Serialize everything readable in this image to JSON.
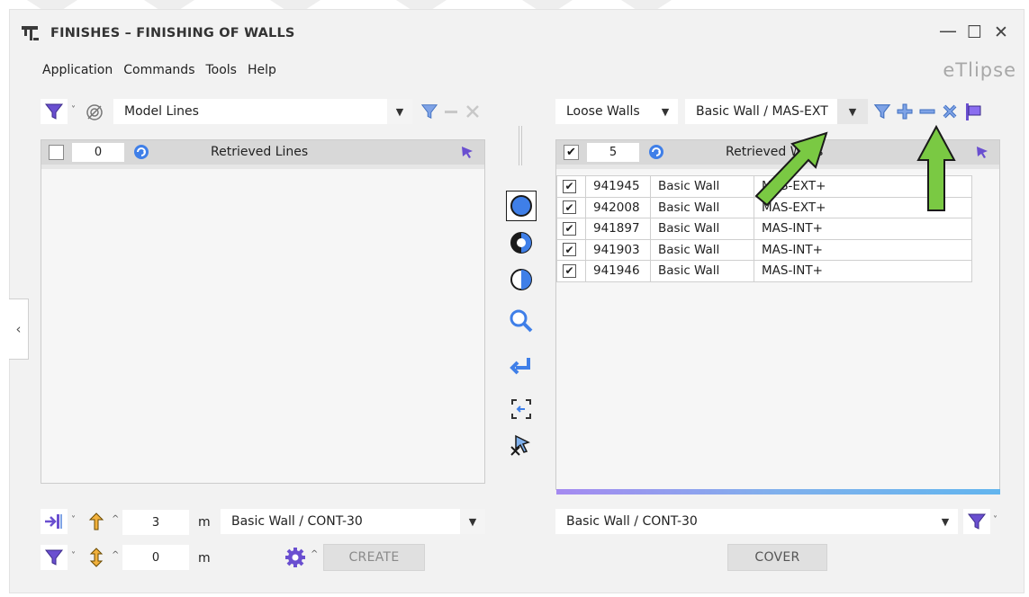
{
  "window": {
    "title": "FINISHES – FINISHING OF WALLS",
    "brand": "eTlipse",
    "minimize": "—",
    "maximize": "☐",
    "close": "✕"
  },
  "menu": [
    "Application",
    "Commands",
    "Tools",
    "Help"
  ],
  "left": {
    "category_select": "Model Lines",
    "count": "0",
    "header_title": "Retrieved Lines",
    "offset_value": "3",
    "offset_unit": "m",
    "wall_type_select": "Basic Wall / CONT-30",
    "height_value": "0",
    "height_unit": "m",
    "create_button": "CREATE"
  },
  "right": {
    "source_select": "Loose Walls",
    "type_select": "Basic Wall / MAS-EXT",
    "count": "5",
    "header_title": "Retrieved Walls",
    "rows": [
      {
        "id": "941945",
        "family": "Basic Wall",
        "type": "MAS-EXT+",
        "checked": true
      },
      {
        "id": "942008",
        "family": "Basic Wall",
        "type": "MAS-EXT+",
        "checked": true
      },
      {
        "id": "941897",
        "family": "Basic Wall",
        "type": "MAS-INT+",
        "checked": true
      },
      {
        "id": "941903",
        "family": "Basic Wall",
        "type": "MAS-INT+",
        "checked": true
      },
      {
        "id": "941946",
        "family": "Basic Wall",
        "type": "MAS-INT+",
        "checked": true
      }
    ],
    "cover_type_select": "Basic Wall / CONT-30",
    "cover_button": "COVER"
  },
  "icons": {
    "filter": "filter-icon",
    "add": "plus-icon",
    "remove": "minus-icon",
    "clear": "clear-icon",
    "refresh": "refresh-icon",
    "select": "select-cursor-icon",
    "zoom": "zoom-icon",
    "settings": "gear-icon"
  },
  "colors": {
    "accent_blue": "#3f7fe8",
    "icon_purple": "#6a4fd0",
    "arrow_green": "#7ac943",
    "header_gray": "#d8d8d8"
  },
  "right_rows_checkmark": "✔"
}
